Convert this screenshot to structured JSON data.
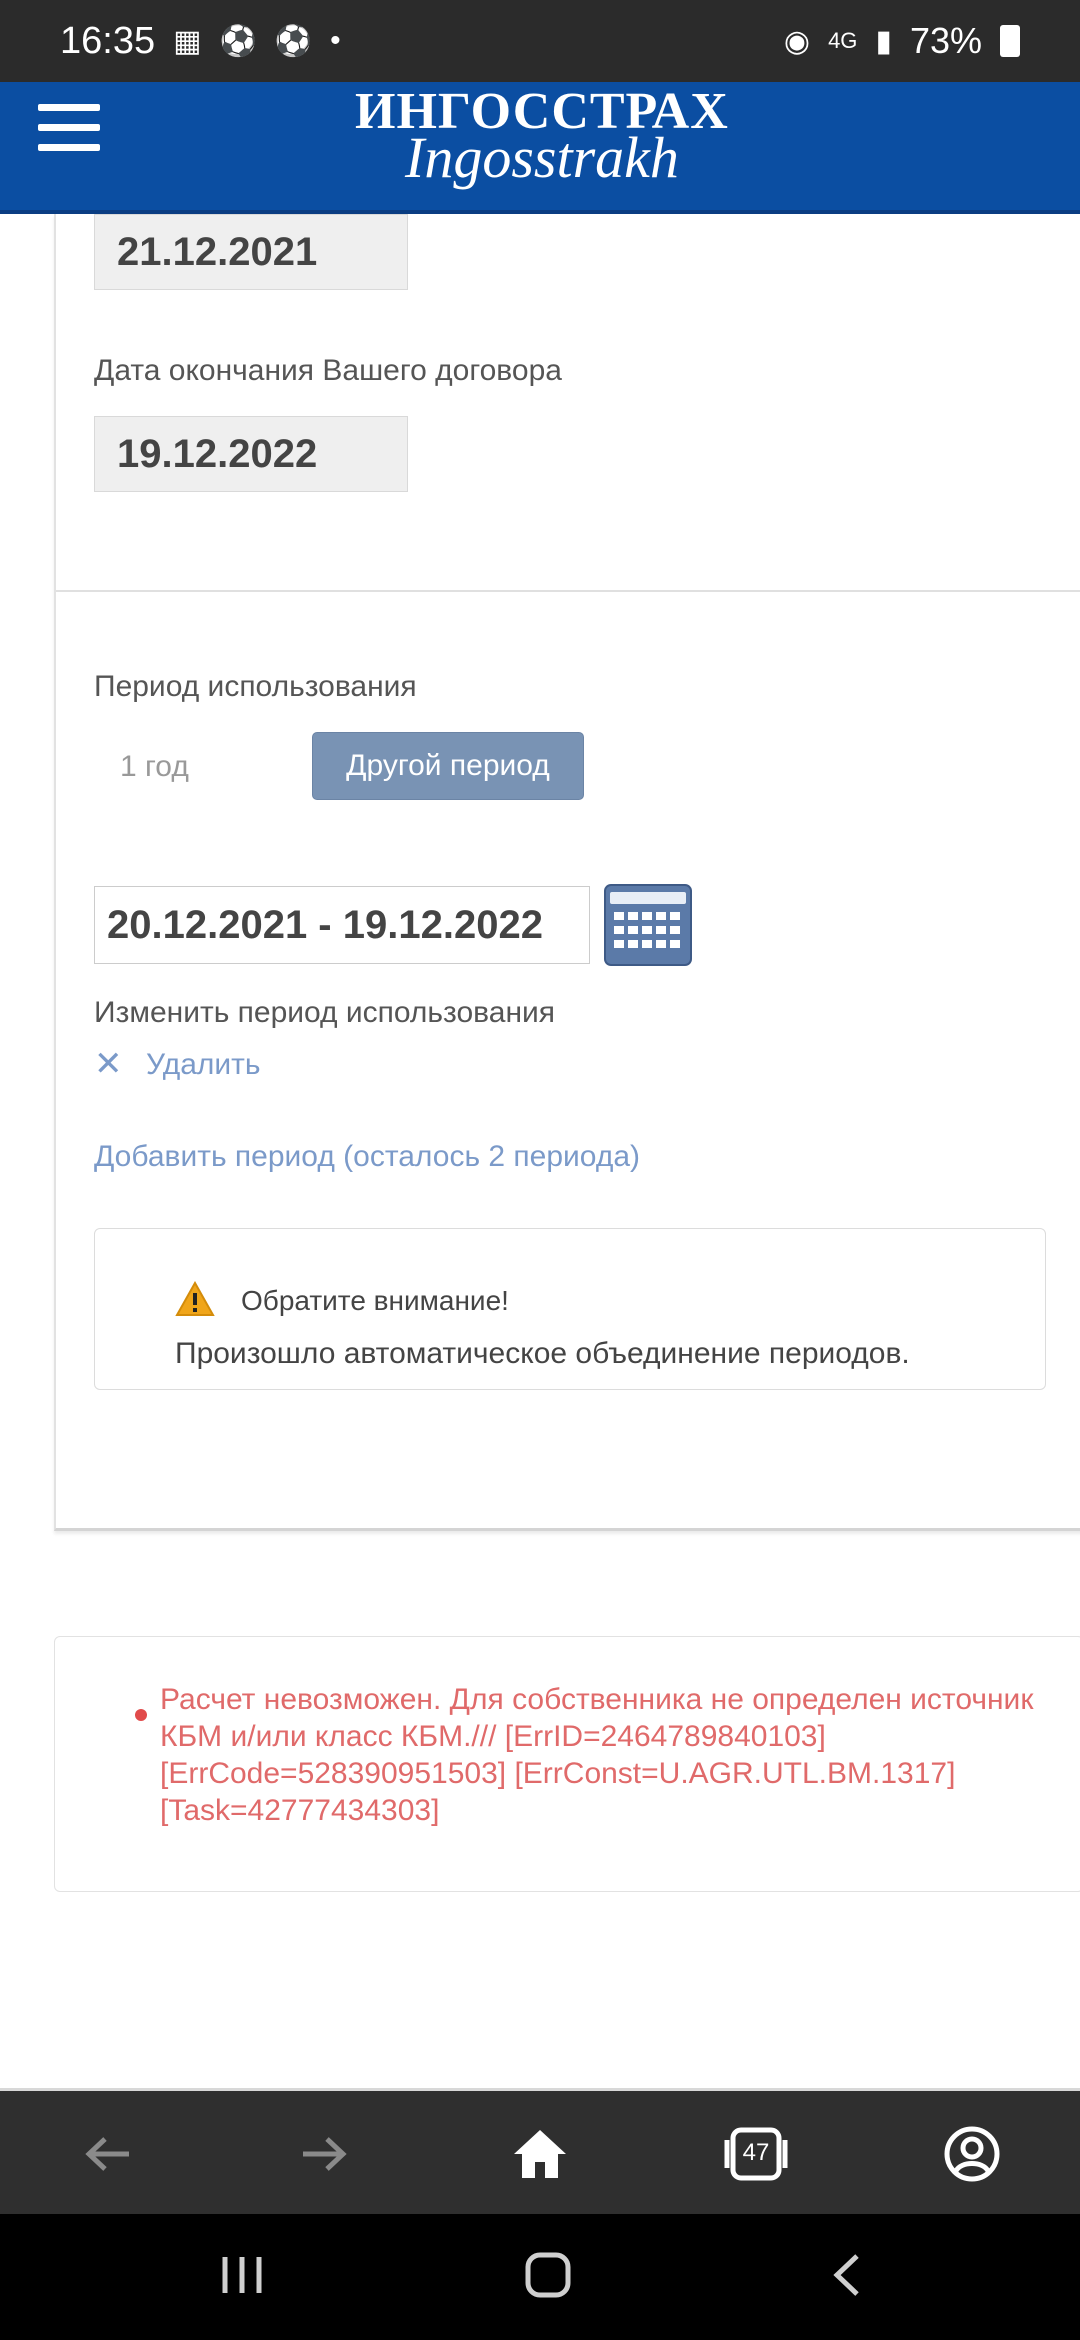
{
  "status_bar": {
    "time": "16:35",
    "network": "4G",
    "battery": "73%"
  },
  "app_bar": {
    "logo_main": "ИНГОССТРАХ",
    "logo_sub": "Ingosstrakh",
    "color": "#0b4ea2"
  },
  "form": {
    "start_date_value": "21.12.2021",
    "end_label": "Дата окончания Вашего договора",
    "end_date_value": "19.12.2022",
    "period_label": "Период использования",
    "period_option_year": "1 год",
    "period_option_other": "Другой период",
    "range_value": "20.12.2021 - 19.12.2022",
    "change_period_label": "Изменить период использования",
    "remove_label": "Удалить",
    "add_period_link": "Добавить период (осталось 2 периода)"
  },
  "notice": {
    "title": "Обратите внимание!",
    "text": "Произошло автоматическое объединение периодов."
  },
  "error": {
    "message": "Расчет невозможен. Для собственника не определен источник КБМ и/или класс КБМ./// [ErrID=2464789840103] [ErrCode=528390951503] [ErrConst=U.AGR.UTL.BM.1317] [Task=42777434303]",
    "color": "#e06a6a"
  },
  "browser": {
    "tab_count": "47"
  }
}
